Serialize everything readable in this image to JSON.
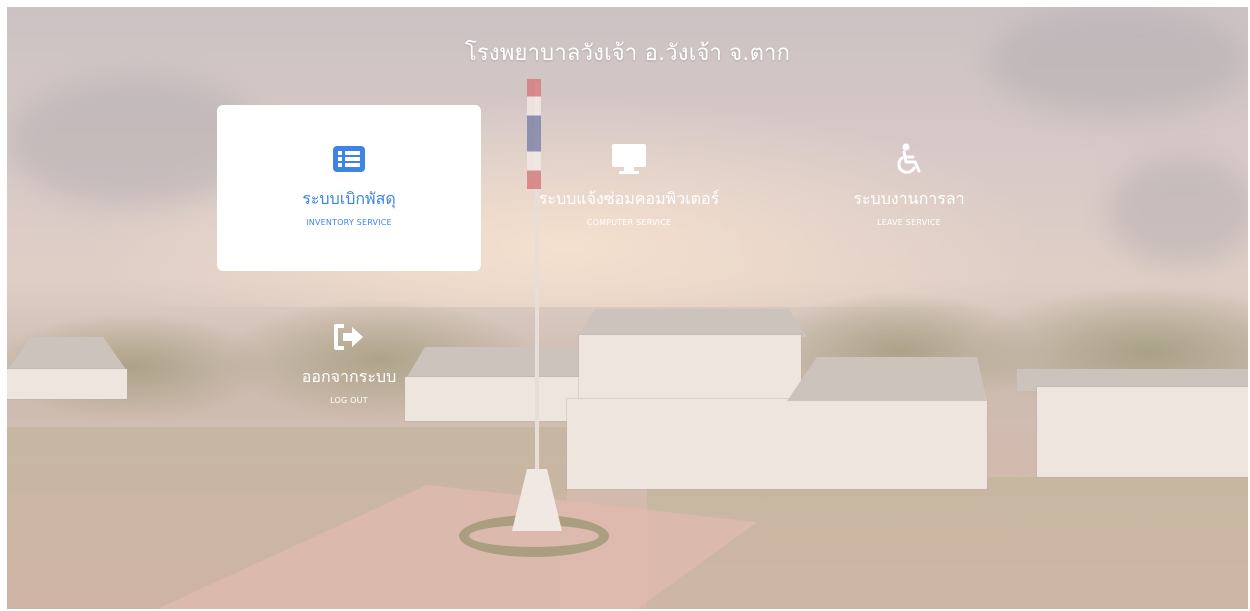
{
  "header": {
    "title": "โรงพยาบาลวังเจ้า อ.วังเจ้า จ.ตาก"
  },
  "menu": {
    "inventory": {
      "label_th": "ระบบเบิกพัสดุ",
      "label_en": "INVENTORY SERVICE",
      "icon": "list-icon",
      "selected": true
    },
    "computer": {
      "label_th": "ระบบแจ้งซ่อมคอมพิวเตอร์",
      "label_en": "COMPUTER SERVICE",
      "icon": "monitor-icon",
      "selected": false
    },
    "leave": {
      "label_th": "ระบบงานการลา",
      "label_en": "LEAVE SERVICE",
      "icon": "wheelchair-icon",
      "selected": false
    },
    "logout": {
      "label_th": "ออกจากระบบ",
      "label_en": "LOG OUT",
      "icon": "sign-out-icon",
      "selected": false
    }
  },
  "colors": {
    "accent": "#3d84e6",
    "tile_text": "#ffffff",
    "active_tile_bg": "#ffffff"
  }
}
